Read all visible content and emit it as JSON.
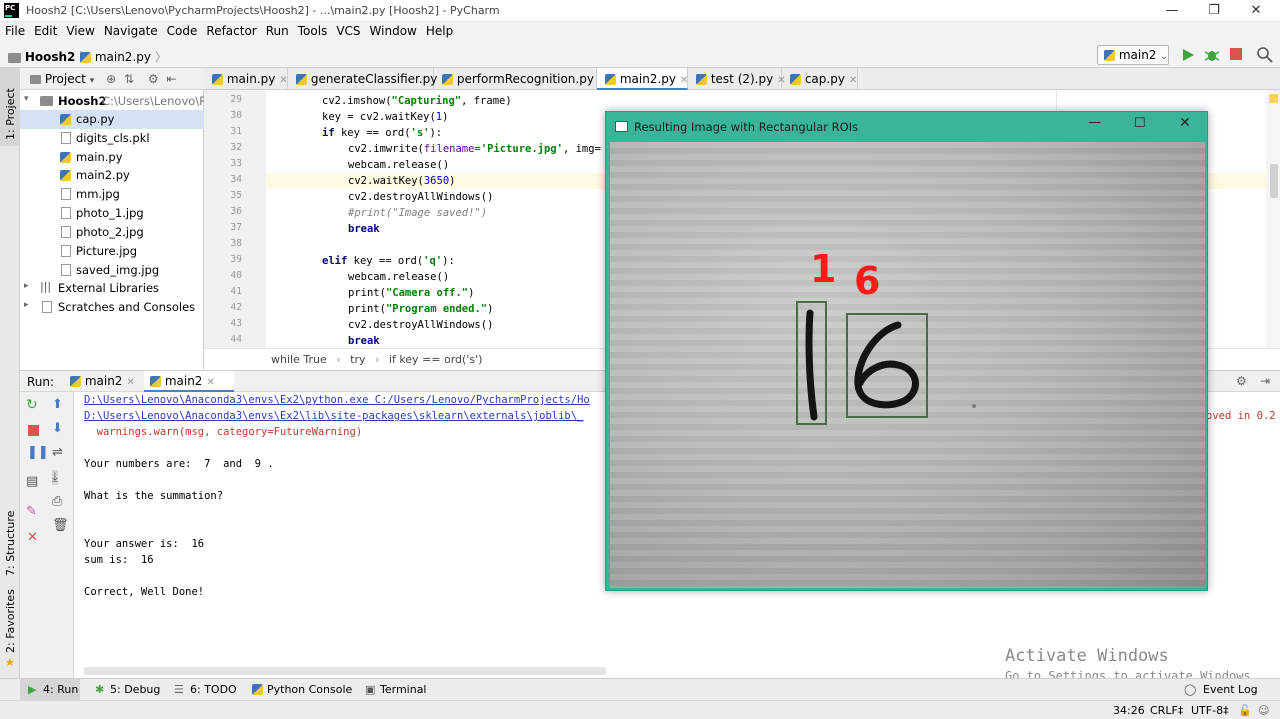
{
  "window": {
    "title": "Hoosh2 [C:\\Users\\Lenovo\\PycharmProjects\\Hoosh2] - ...\\main2.py [Hoosh2] - PyCharm",
    "controls": [
      "—",
      "❐",
      "✕"
    ]
  },
  "menu": [
    "File",
    "Edit",
    "View",
    "Navigate",
    "Code",
    "Refactor",
    "Run",
    "Tools",
    "VCS",
    "Window",
    "Help"
  ],
  "navbar": {
    "project": "Hoosh2",
    "file": "main2.py",
    "run_config": "main2"
  },
  "left_strip": {
    "project_label": "1: Project",
    "structure_label": "7: Structure",
    "favorites_label": "2: Favorites"
  },
  "project_panel": {
    "header": "Project",
    "root_name": "Hoosh2",
    "root_path": "C:\\Users\\Lenovo\\Py",
    "files": [
      "cap.py",
      "digits_cls.pkl",
      "main.py",
      "main2.py",
      "mm.jpg",
      "photo_1.jpg",
      "photo_2.jpg",
      "Picture.jpg",
      "saved_img.jpg"
    ],
    "external": "External Libraries",
    "scratches": "Scratches and Consoles"
  },
  "tabs": [
    "main.py",
    "generateClassifier.py",
    "performRecognition.py",
    "main2.py",
    "test (2).py",
    "cap.py"
  ],
  "editor": {
    "line_numbers": [
      "29",
      "30",
      "31",
      "32",
      "33",
      "34",
      "35",
      "36",
      "37",
      "38",
      "39",
      "40",
      "41",
      "42",
      "43",
      "44"
    ],
    "lines": {
      "l29": "cv2.imshow(",
      "l29s": "\"Capturing\"",
      "l29e": ", frame)",
      "l30": "key = cv2.waitKey(",
      "l30n": "1",
      "l30e": ")",
      "l31k": "if",
      "l31": " key == ord(",
      "l31s": "'s'",
      "l31e": "):",
      "l32": "cv2.imwrite(",
      "l32p": "filename=",
      "l32s": "'Picture.jpg'",
      "l32e": ", img=",
      "l33": "webcam.release()",
      "l34": "cv2.waitKey(",
      "l34n": "3650",
      "l34e": ")",
      "l35": "cv2.destroyAllWindows()",
      "l36": "#print(\"Image saved!\")",
      "l37": "break",
      "l39k": "elif",
      "l39": " key == ord(",
      "l39s": "'q'",
      "l39e": "):",
      "l40": "webcam.release()",
      "l41": "print(",
      "l41s": "\"Camera off.\"",
      "l41e": ")",
      "l42": "print(",
      "l42s": "\"Program ended.\"",
      "l42e": ")",
      "l43": "cv2.destroyAllWindows()",
      "l44": "break"
    },
    "right_cutoff": "oved in 0.2",
    "breadcrumbs": [
      "while True",
      "try",
      "if key == ord('s')"
    ]
  },
  "run_panel": {
    "label": "Run:",
    "tabs": [
      "main2",
      "main2"
    ],
    "output": {
      "line1": "D:\\Users\\Lenovo\\Anaconda3\\envs\\Ex2\\python.exe C:/Users/Lenovo/PycharmProjects/Ho",
      "line2": "D:\\Users\\Lenovo\\Anaconda3\\envs\\Ex2\\lib\\site-packages\\sklearn\\externals\\joblib\\_",
      "line3": "  warnings.warn(msg, category=FutureWarning)",
      "line4": "Your numbers are:  7  and  9 .",
      "line5": "What is the summation?",
      "line6": "Your answer is:  16",
      "line7": "sum is:  16",
      "line8": "Correct, Well Done!"
    }
  },
  "bottom_tools": [
    "4: Run",
    "5: Debug",
    "6: TODO",
    "Python Console",
    "Terminal",
    "Event Log"
  ],
  "status": {
    "position": "34:26",
    "line_sep": "CRLF‡",
    "encoding": "UTF-8‡"
  },
  "watermark": {
    "title": "Activate Windows",
    "sub": "Go to Settings to activate Windows."
  },
  "cv_window": {
    "title": "Resulting Image with Rectangular ROIs",
    "label_left": "1",
    "label_right": "6",
    "digit_left": "1",
    "digit_right": "6",
    "controls": [
      "—",
      "☐",
      "✕"
    ]
  }
}
